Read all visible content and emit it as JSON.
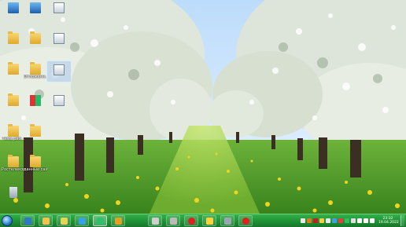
{
  "desktop": {
    "icons": [
      {
        "name": "computer-icon",
        "label": ""
      },
      {
        "name": "network-icon",
        "label": ""
      },
      {
        "name": "app-icon",
        "label": ""
      },
      {
        "name": "folder-icon",
        "label": ""
      },
      {
        "name": "folder-icon",
        "label": ""
      },
      {
        "name": "app-icon",
        "label": ""
      },
      {
        "name": "folder-icon",
        "label": ""
      },
      {
        "name": "folder-icon",
        "label": "Отложенн..."
      },
      {
        "name": "app-icon",
        "label": ""
      },
      {
        "name": "folder-icon",
        "label": ""
      },
      {
        "name": "flag-icon",
        "label": ""
      },
      {
        "name": "app-icon",
        "label": ""
      },
      {
        "name": "folder-icon",
        "label": "Тема раб..."
      },
      {
        "name": "folder-icon",
        "label": ""
      },
      {
        "name": "folder-icon",
        "label": "Ростелеком Сканер..."
      },
      {
        "name": "folder-icon",
        "label": "данные сайтов ф..."
      },
      {
        "name": "trash-icon",
        "label": ""
      }
    ]
  },
  "taskbar": {
    "clock_time": "23:32",
    "clock_date": "19.04.2022",
    "pinned": [
      {
        "name": "explorer-icon",
        "color": "#2f78c8"
      },
      {
        "name": "folder-icon",
        "color": "#f2c24a"
      },
      {
        "name": "app-icon",
        "color": "#e6d35a"
      },
      {
        "name": "browser-icon",
        "color": "#3aa0e6"
      },
      {
        "name": "mail-icon",
        "color": "#2ec06c"
      },
      {
        "name": "tools-icon",
        "color": "#e0a21e"
      },
      {
        "name": "player-icon",
        "color": "#cfcfcf"
      },
      {
        "name": "media-icon",
        "color": "#bbbbbb"
      },
      {
        "name": "record-icon",
        "color": "#e02020"
      },
      {
        "name": "app-icon",
        "color": "#ffd23c"
      },
      {
        "name": "camera-icon",
        "color": "#9aa7b2"
      },
      {
        "name": "record-icon",
        "color": "#e02020"
      }
    ],
    "tray_icons": [
      {
        "name": "expand-tray-icon",
        "color": "#e9e9e9"
      },
      {
        "name": "antivirus-icon",
        "color": "#e07a20"
      },
      {
        "name": "security-icon",
        "color": "#c02020"
      },
      {
        "name": "app-icon",
        "color": "#f0d040"
      },
      {
        "name": "network-tray-icon",
        "color": "#e9e9e9"
      },
      {
        "name": "app-icon",
        "color": "#40a0e0"
      },
      {
        "name": "app-icon",
        "color": "#e04040"
      },
      {
        "name": "app-icon",
        "color": "#30c060"
      },
      {
        "name": "app-icon",
        "color": "#e0e0e0"
      },
      {
        "name": "flag-icon",
        "color": "#ffffff"
      },
      {
        "name": "speaker-icon",
        "color": "#ffffff"
      },
      {
        "name": "battery-icon",
        "color": "#ffffff"
      }
    ]
  },
  "colors": {
    "taskbar": "#1e8f34",
    "sky": "#cfe6ff",
    "grass": "#3f8f1e",
    "blossom": "#f2f5ee",
    "dandelion": "#f2d41e"
  }
}
